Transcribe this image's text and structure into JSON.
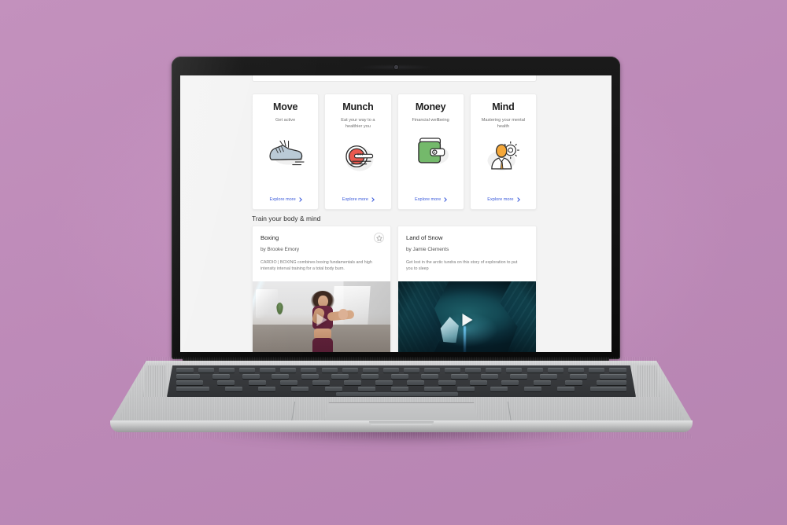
{
  "scene": {
    "background_color": "#bf8cba",
    "device": "laptop-mockup"
  },
  "page": {
    "background_color": "#f3f3f3",
    "pillars": [
      {
        "title": "Move",
        "subtitle": "Get active",
        "icon": "running-shoe-icon",
        "link_label": "Explore more"
      },
      {
        "title": "Munch",
        "subtitle": "Eat your way to a healthier you",
        "icon": "plate-fork-icon",
        "link_label": "Explore more"
      },
      {
        "title": "Money",
        "subtitle": "Financial wellbeing",
        "icon": "wallet-icon",
        "link_label": "Explore more"
      },
      {
        "title": "Mind",
        "subtitle": "Mastering your mental health",
        "icon": "person-gear-icon",
        "link_label": "Explore more"
      }
    ],
    "section": {
      "heading": "Train your body & mind",
      "cards": [
        {
          "title": "Boxing",
          "author": "by Brooke Emory",
          "description": "CARDIO | BOXING combines boxing fundamentals and high intensity interval training for a total body burn.",
          "media": "boxing-video-thumbnail",
          "favorite_icon": "star-icon",
          "play_icon": "play-icon"
        },
        {
          "title": "Land of Snow",
          "author": "by Jamie Clements",
          "description": "Get lost in the arctic tundra on this story of exploration to put you to sleep",
          "media": "snow-cave-video-thumbnail",
          "play_icon": "play-icon"
        }
      ]
    }
  },
  "colors": {
    "link": "#3b5bdb",
    "page_bg": "#f3f3f3",
    "card_bg": "#ffffff",
    "title": "#1d1d1d",
    "muted": "#7a7a7a"
  }
}
